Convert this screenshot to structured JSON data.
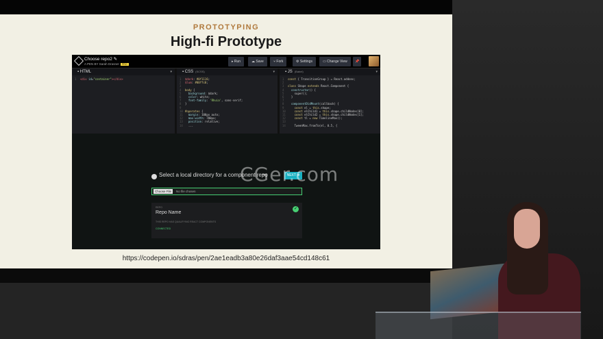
{
  "slide": {
    "eyebrow": "PROTOTYPING",
    "title": "High-fi Prototype",
    "url": "https://codepen.io/sdras/pen/2ae1eadb3a80e26daf3aae54cd148c61"
  },
  "codepen": {
    "title": "Choose repo2 ✎",
    "author": "A PEN BY Sarah Drasner",
    "pro": "PRO",
    "buttons": [
      "▸ Run",
      "☁ Save",
      "⑂ Fork",
      "⚙ Settings",
      "▭ Change View",
      "📌"
    ],
    "editors": {
      "html": {
        "label": "HTML",
        "sub": ""
      },
      "css": {
        "label": "CSS",
        "sub": "(SCSS)"
      },
      "js": {
        "label": "JS",
        "sub": "(Babel)"
      }
    },
    "result": {
      "select_label": "Select a local directory for a component repo",
      "next_button": "NEXT ➔",
      "file_button": "Choose File",
      "file_status": "No file chosen",
      "card_small": "REPO",
      "card_name": "Repo Name",
      "card_note": "THIS REPO HAS QUALIFYING REACT COMPONENTS",
      "card_status": "CONNECTED",
      "check": "✓"
    }
  },
  "watermark": "CGer.com"
}
